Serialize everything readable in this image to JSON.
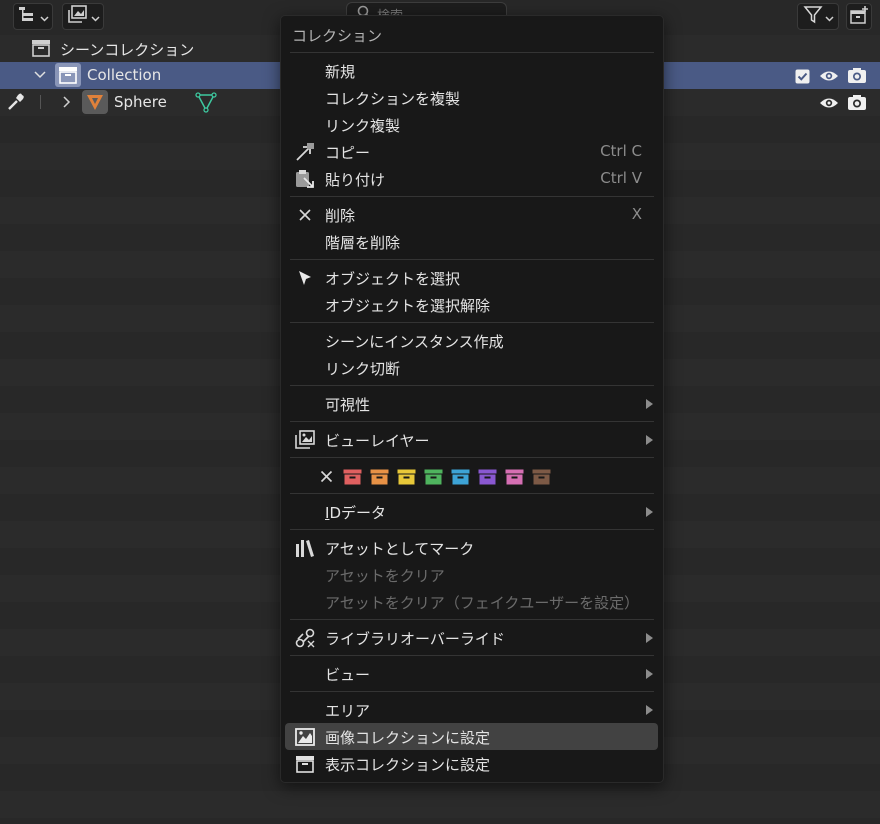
{
  "header": {
    "search_placeholder": "検索"
  },
  "outliner": {
    "scene_collection_label": "シーンコレクション",
    "rows": [
      {
        "label": "Collection"
      },
      {
        "label": "Sphere"
      }
    ]
  },
  "menu": {
    "title": "コレクション",
    "items": {
      "new": "新規",
      "duplicate_collection": "コレクションを複製",
      "duplicate_linked": "リンク複製",
      "copy": "コピー",
      "copy_shortcut": "Ctrl C",
      "paste": "貼り付け",
      "paste_shortcut": "Ctrl V",
      "delete": "削除",
      "delete_shortcut": "X",
      "delete_hierarchy": "階層を削除",
      "select_objects": "オブジェクトを選択",
      "deselect_objects": "オブジェクトを選択解除",
      "instance_to_scene": "シーンにインスタンス作成",
      "make_single_user": "リンク切断",
      "visibility": "可視性",
      "view_layer": "ビューレイヤー",
      "id_data_first": "I",
      "id_data_rest": "Dデータ",
      "mark_as_asset": "アセットとしてマーク",
      "clear_asset": "アセットをクリア",
      "clear_asset_fake_user": "アセットをクリア（フェイクユーザーを設定）",
      "library_override": "ライブラリオーバーライド",
      "view": "ビュー",
      "area": "エリア",
      "set_render_collection": "画像コレクションに設定",
      "set_viewport_collection": "表示コレクションに設定"
    },
    "color_tags": [
      "#e06060",
      "#e89246",
      "#e8c839",
      "#4fb45e",
      "#3da3d6",
      "#8a58d1",
      "#d66fb3",
      "#7d5a46"
    ]
  },
  "colors": {
    "selection_row": "#4a5a85",
    "menu_bg": "#181818",
    "highlight": "#424242"
  }
}
